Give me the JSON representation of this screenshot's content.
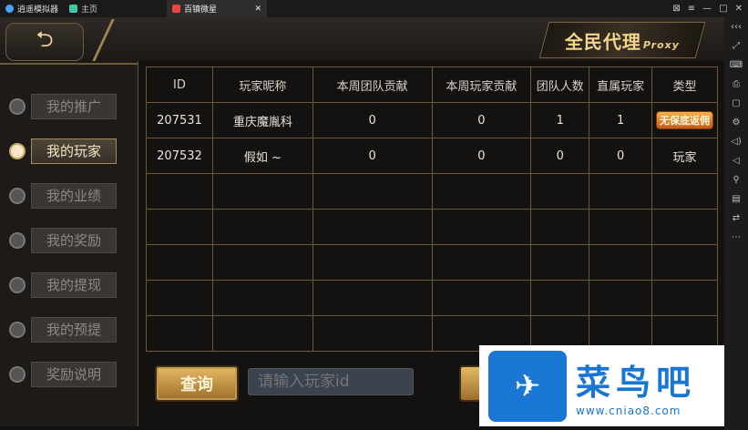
{
  "window": {
    "app_name": "逍遥模拟器",
    "tabs": [
      {
        "label": "主页"
      },
      {
        "label": "百镇微星"
      }
    ],
    "controls": [
      "⊠",
      "≡",
      "—",
      "□",
      "✕"
    ],
    "right_toolbar": [
      "‹‹‹",
      "⤢",
      "⌨",
      "⎙",
      "▢",
      "⚙",
      "◁)",
      "◁",
      "⚲",
      "▤",
      "⇄",
      "⋯"
    ]
  },
  "header": {
    "back_label": "⮌",
    "badge_title": "全民代理",
    "badge_sub": "Proxy"
  },
  "sidebar": {
    "items": [
      {
        "label": "我的推广",
        "active": false
      },
      {
        "label": "我的玩家",
        "active": true
      },
      {
        "label": "我的业绩",
        "active": false
      },
      {
        "label": "我的奖励",
        "active": false
      },
      {
        "label": "我的提现",
        "active": false
      },
      {
        "label": "我的预提",
        "active": false
      },
      {
        "label": "奖励说明",
        "active": false
      }
    ]
  },
  "table": {
    "headers": [
      "ID",
      "玩家昵称",
      "本周团队贡献",
      "本周玩家贡献",
      "团队人数",
      "直属玩家",
      "类型"
    ],
    "rows": [
      [
        "207531",
        "重庆魔胤科",
        "0",
        "0",
        "1",
        "1",
        "无保底返佣"
      ],
      [
        "207532",
        "假如 ~",
        "0",
        "0",
        "0",
        "0",
        "玩家"
      ]
    ]
  },
  "search": {
    "button_label": "查询",
    "placeholder": "请输入玩家id"
  },
  "watermark": {
    "title": "菜鸟吧",
    "url": "www.cniao8.com",
    "logo": "✈"
  },
  "colors": {
    "gold": "#f2d78d",
    "border": "#6b5838",
    "tag_orange": "#e98a2c"
  }
}
